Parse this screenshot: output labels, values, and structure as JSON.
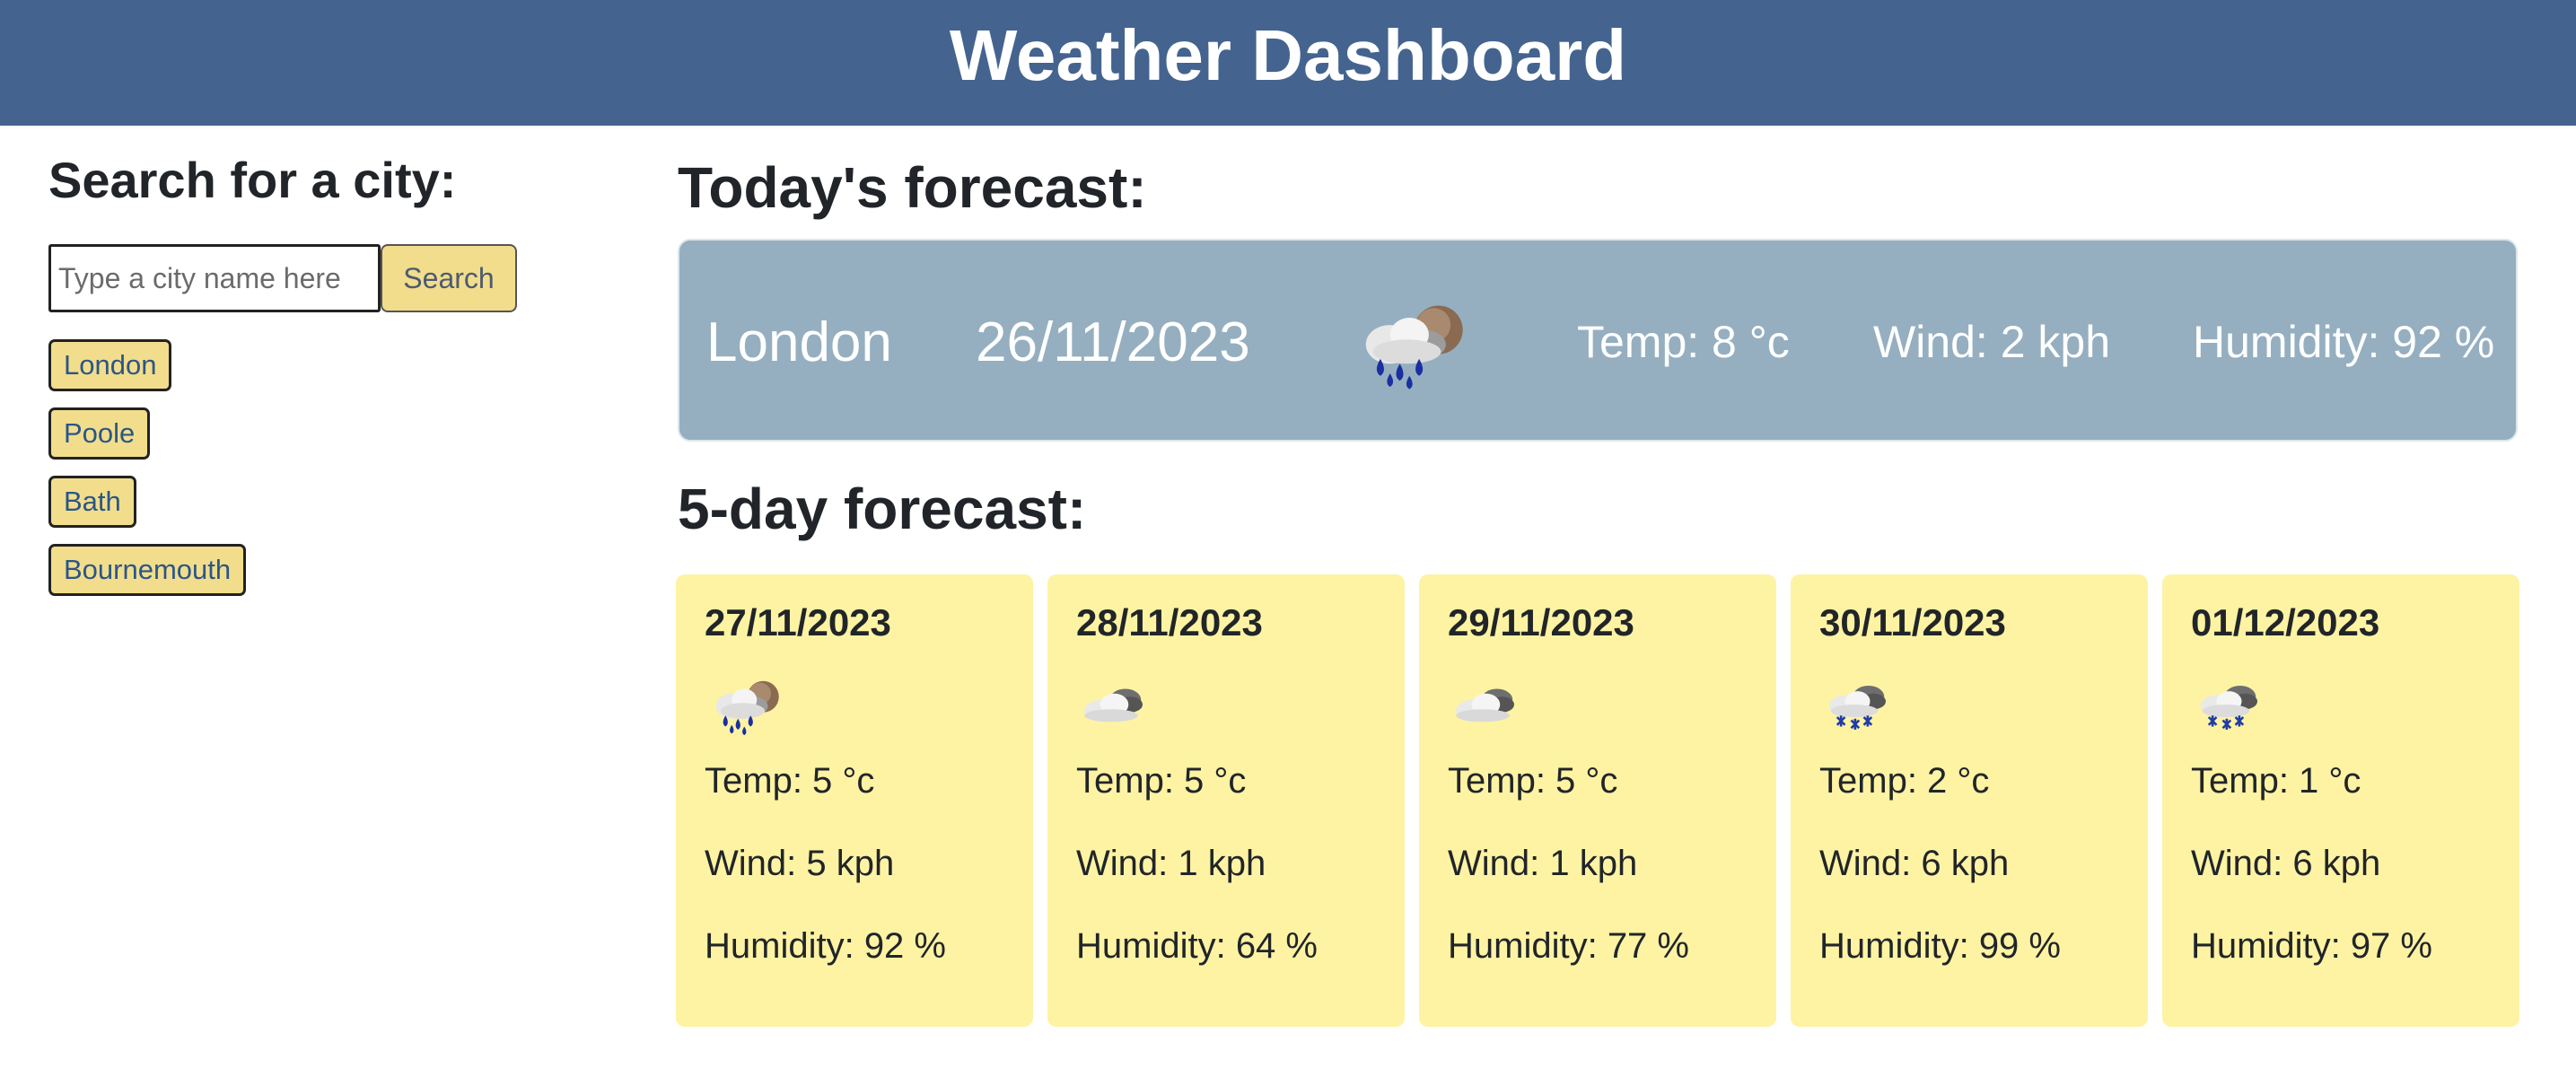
{
  "header": {
    "title": "Weather Dashboard"
  },
  "sidebar": {
    "heading": "Search for a city:",
    "search_placeholder": "Type a city name here",
    "search_button": "Search",
    "history": [
      "London",
      "Poole",
      "Bath",
      "Bournemouth"
    ]
  },
  "today": {
    "heading": "Today's forecast:",
    "city": "London",
    "date": "26/11/2023",
    "icon": "rain-cloud-sun-icon",
    "temp": "Temp: 8 °c",
    "wind": "Wind: 2 kph",
    "humidity": "Humidity: 92 %"
  },
  "five_day": {
    "heading": "5-day forecast:",
    "days": [
      {
        "date": "27/11/2023",
        "icon": "rain-cloud-sun-icon",
        "temp": "Temp: 5 °c",
        "wind": "Wind: 5 kph",
        "humidity": "Humidity: 92 %"
      },
      {
        "date": "28/11/2023",
        "icon": "cloud-icon",
        "temp": "Temp: 5 °c",
        "wind": "Wind: 1 kph",
        "humidity": "Humidity: 64 %"
      },
      {
        "date": "29/11/2023",
        "icon": "cloud-icon",
        "temp": "Temp: 5 °c",
        "wind": "Wind: 1 kph",
        "humidity": "Humidity: 77 %"
      },
      {
        "date": "30/11/2023",
        "icon": "snow-cloud-icon",
        "temp": "Temp: 2 °c",
        "wind": "Wind: 6 kph",
        "humidity": "Humidity: 99 %"
      },
      {
        "date": "01/12/2023",
        "icon": "snow-cloud-icon",
        "temp": "Temp: 1 °c",
        "wind": "Wind: 6 kph",
        "humidity": "Humidity: 97 %"
      }
    ]
  },
  "colors": {
    "header_bg": "#44648f",
    "today_bg": "#95afc0",
    "card_bg": "#fdf3a3",
    "button_bg": "#f1dd8c"
  }
}
